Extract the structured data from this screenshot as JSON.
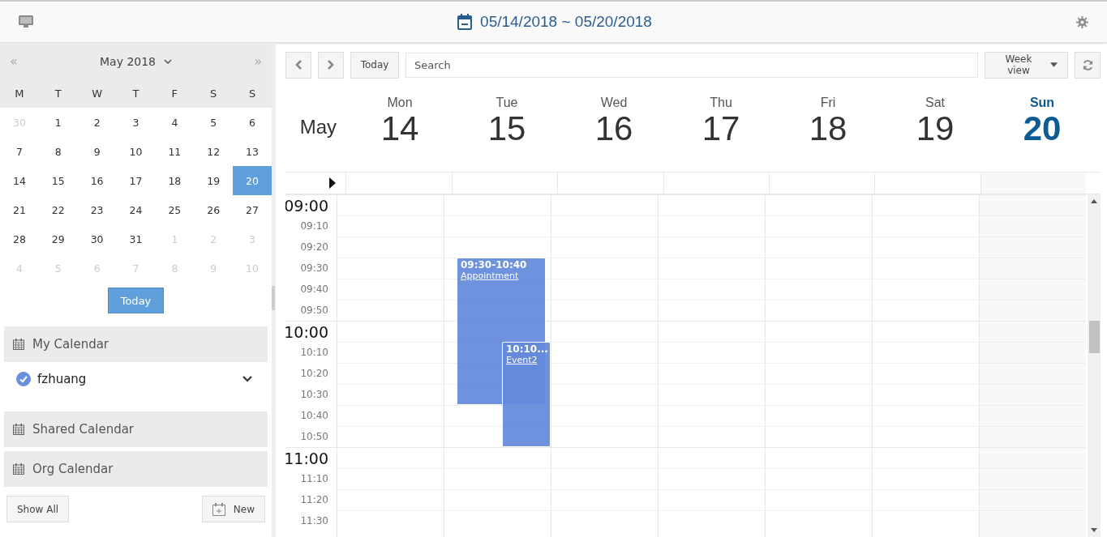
{
  "header": {
    "date_range": "05/14/2018 ~ 05/20/2018"
  },
  "mini_calendar": {
    "prev": "«",
    "month_label": "May 2018",
    "next": "»",
    "weekdays": [
      "M",
      "T",
      "W",
      "T",
      "F",
      "S",
      "S"
    ],
    "weeks": [
      [
        {
          "day": "30",
          "muted": true,
          "selected": false
        },
        {
          "day": "1",
          "muted": false,
          "selected": false
        },
        {
          "day": "2",
          "muted": false,
          "selected": false
        },
        {
          "day": "3",
          "muted": false,
          "selected": false
        },
        {
          "day": "4",
          "muted": false,
          "selected": false
        },
        {
          "day": "5",
          "muted": false,
          "selected": false
        },
        {
          "day": "6",
          "muted": false,
          "selected": false
        }
      ],
      [
        {
          "day": "7",
          "muted": false,
          "selected": false
        },
        {
          "day": "8",
          "muted": false,
          "selected": false
        },
        {
          "day": "9",
          "muted": false,
          "selected": false
        },
        {
          "day": "10",
          "muted": false,
          "selected": false
        },
        {
          "day": "11",
          "muted": false,
          "selected": false
        },
        {
          "day": "12",
          "muted": false,
          "selected": false
        },
        {
          "day": "13",
          "muted": false,
          "selected": false
        }
      ],
      [
        {
          "day": "14",
          "muted": false,
          "selected": false
        },
        {
          "day": "15",
          "muted": false,
          "selected": false
        },
        {
          "day": "16",
          "muted": false,
          "selected": false
        },
        {
          "day": "17",
          "muted": false,
          "selected": false
        },
        {
          "day": "18",
          "muted": false,
          "selected": false
        },
        {
          "day": "19",
          "muted": false,
          "selected": false
        },
        {
          "day": "20",
          "muted": false,
          "selected": true
        }
      ],
      [
        {
          "day": "21",
          "muted": false,
          "selected": false
        },
        {
          "day": "22",
          "muted": false,
          "selected": false
        },
        {
          "day": "23",
          "muted": false,
          "selected": false
        },
        {
          "day": "24",
          "muted": false,
          "selected": false
        },
        {
          "day": "25",
          "muted": false,
          "selected": false
        },
        {
          "day": "26",
          "muted": false,
          "selected": false
        },
        {
          "day": "27",
          "muted": false,
          "selected": false
        }
      ],
      [
        {
          "day": "28",
          "muted": false,
          "selected": false
        },
        {
          "day": "29",
          "muted": false,
          "selected": false
        },
        {
          "day": "30",
          "muted": false,
          "selected": false
        },
        {
          "day": "31",
          "muted": false,
          "selected": false
        },
        {
          "day": "1",
          "muted": true,
          "selected": false
        },
        {
          "day": "2",
          "muted": true,
          "selected": false
        },
        {
          "day": "3",
          "muted": true,
          "selected": false
        }
      ],
      [
        {
          "day": "4",
          "muted": true,
          "selected": false
        },
        {
          "day": "5",
          "muted": true,
          "selected": false
        },
        {
          "day": "6",
          "muted": true,
          "selected": false
        },
        {
          "day": "7",
          "muted": true,
          "selected": false
        },
        {
          "day": "8",
          "muted": true,
          "selected": false
        },
        {
          "day": "9",
          "muted": true,
          "selected": false
        },
        {
          "day": "10",
          "muted": true,
          "selected": false
        }
      ]
    ],
    "today_button": "Today"
  },
  "calendar_groups": [
    {
      "label": "My Calendar",
      "calendars": [
        {
          "name": "fzhuang",
          "checked": true
        }
      ]
    },
    {
      "label": "Shared Calendar"
    },
    {
      "label": "Org Calendar"
    }
  ],
  "sidebar_buttons": {
    "show_all": "Show All",
    "new": "New"
  },
  "toolbar": {
    "today": "Today",
    "search_placeholder": "Search",
    "view": "Week view"
  },
  "week": {
    "month": "May",
    "days": [
      {
        "name": "Mon",
        "date": "14",
        "selected": false
      },
      {
        "name": "Tue",
        "date": "15",
        "selected": false,
        "events": [
          {
            "time": "09:30-10:40",
            "title": "Appointment"
          },
          {
            "time": "10:10...",
            "title": "Event2"
          }
        ]
      },
      {
        "name": "Wed",
        "date": "16",
        "selected": false
      },
      {
        "name": "Thu",
        "date": "17",
        "selected": false
      },
      {
        "name": "Fri",
        "date": "18",
        "selected": false
      },
      {
        "name": "Sat",
        "date": "19",
        "selected": false
      },
      {
        "name": "Sun",
        "date": "20",
        "selected": true
      }
    ],
    "times": [
      {
        "label": "09:00",
        "kind": "hour"
      },
      {
        "label": "09:10",
        "kind": "minor"
      },
      {
        "label": "09:20",
        "kind": "minor"
      },
      {
        "label": "09:30",
        "kind": "minor"
      },
      {
        "label": "09:40",
        "kind": "minor"
      },
      {
        "label": "09:50",
        "kind": "minor"
      },
      {
        "label": "10:00",
        "kind": "hour"
      },
      {
        "label": "10:10",
        "kind": "minor"
      },
      {
        "label": "10:20",
        "kind": "minor"
      },
      {
        "label": "10:30",
        "kind": "minor"
      },
      {
        "label": "10:40",
        "kind": "minor"
      },
      {
        "label": "10:50",
        "kind": "minor"
      },
      {
        "label": "11:00",
        "kind": "hour"
      },
      {
        "label": "11:10",
        "kind": "minor"
      },
      {
        "label": "11:20",
        "kind": "minor"
      },
      {
        "label": "11:30",
        "kind": "minor"
      }
    ]
  }
}
